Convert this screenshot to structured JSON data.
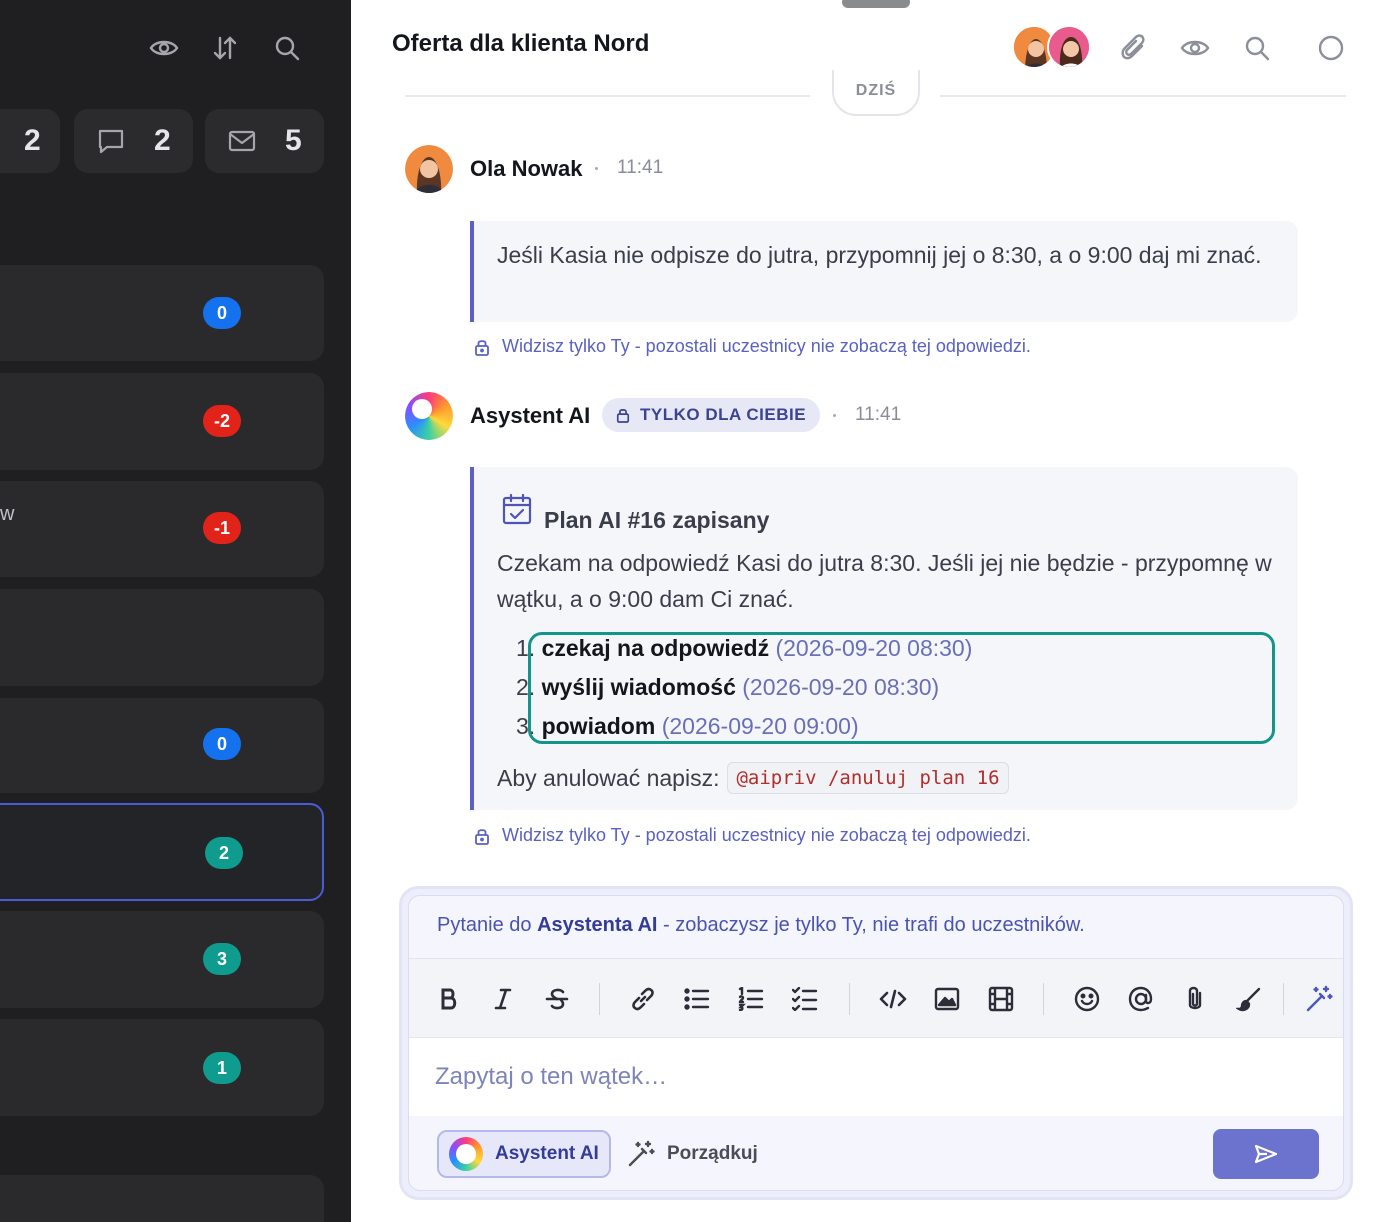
{
  "sidebar": {
    "counters": [
      {
        "name": "counter-a",
        "icon": "hidden-icon",
        "value": "2"
      },
      {
        "name": "counter-comments",
        "icon": "comment-icon",
        "value": "2"
      },
      {
        "name": "counter-mail",
        "icon": "mail-icon",
        "value": "5"
      }
    ],
    "card_fragment": "w",
    "badges": [
      "0",
      "-2",
      "-1",
      "0",
      "2",
      "3",
      "1"
    ]
  },
  "header": {
    "title": "Oferta dla klienta Nord",
    "divider_label": "DZIŚ"
  },
  "messages": {
    "user": {
      "name": "Ola Nowak",
      "time": "11:41",
      "text": "Jeśli Kasia nie odpisze do jutra, przypomnij jej o 8:30, a o 9:00 daj mi znać."
    },
    "ai": {
      "name": "Asystent AI",
      "badge": "TYLKO DLA CIEBIE",
      "time": "11:41",
      "plan_title": "Plan AI #16 zapisany",
      "plan_text": "Czekam na odpowiedź Kasi do jutra 8:30. Jeśli jej nie będzie - przypomnę w wątku, a o 9:00 dam Ci znać.",
      "steps": [
        {
          "num": "1.",
          "action": "czekaj na odpowiedź",
          "date": "(2026-09-20 08:30)"
        },
        {
          "num": "2.",
          "action": "wyślij wiadomość",
          "date": "(2026-09-20 08:30)"
        },
        {
          "num": "3.",
          "action": "powiadom",
          "date": "(2026-09-20 09:00)"
        }
      ],
      "cancel_label": "Aby anulować napisz:",
      "cancel_command": "@aipriv /anuluj plan 16"
    },
    "private_note": "Widzisz tylko Ty - pozostali uczestnicy nie zobaczą tej odpowiedzi."
  },
  "composer": {
    "hint_prefix": "Pytanie do ",
    "hint_bold": "Asystenta AI",
    "hint_suffix": " - zobaczysz je tylko Ty, nie trafi do uczestników.",
    "placeholder": "Zapytaj o ten wątek…",
    "ai_button": "Asystent AI",
    "tidy_button": "Porządkuj"
  },
  "colors": {
    "accent": "#5b62c4",
    "highlight": "#12968a",
    "badge_blue": "#1472ee",
    "badge_red": "#e2231a",
    "badge_teal": "#0f9b8e"
  }
}
